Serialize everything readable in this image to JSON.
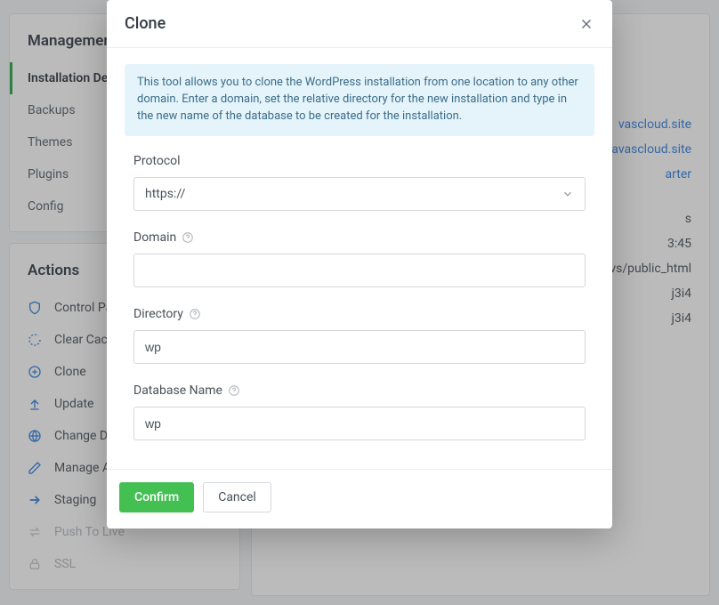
{
  "sidebar": {
    "management_title": "Management",
    "management_items": [
      "Installation Details",
      "Backups",
      "Themes",
      "Plugins",
      "Config"
    ],
    "actions_title": "Actions",
    "actions": [
      "Control Panel",
      "Clear Cache",
      "Clone",
      "Update",
      "Change Domain",
      "Manage Auto-Backup",
      "Staging",
      "Push To Live",
      "SSL"
    ]
  },
  "main": {
    "link1": "vascloud.site",
    "link2": "ps.savascloud.site",
    "link3": "arter",
    "val_s": "s",
    "val_time": "3:45",
    "val_path": "osvs/public_html",
    "val_db1": "j3i4",
    "val_db2": "j3i4"
  },
  "modal": {
    "title": "Clone",
    "info": "This tool allows you to clone the WordPress installation from one location to any other domain. Enter a domain, set the relative directory for the new installation and type in the new name of the database to be created for the installation.",
    "labels": {
      "protocol": "Protocol",
      "domain": "Domain",
      "directory": "Directory",
      "database": "Database Name"
    },
    "values": {
      "protocol": "https://",
      "domain": "",
      "directory": "wp",
      "database": "wp"
    },
    "buttons": {
      "confirm": "Confirm",
      "cancel": "Cancel"
    }
  }
}
